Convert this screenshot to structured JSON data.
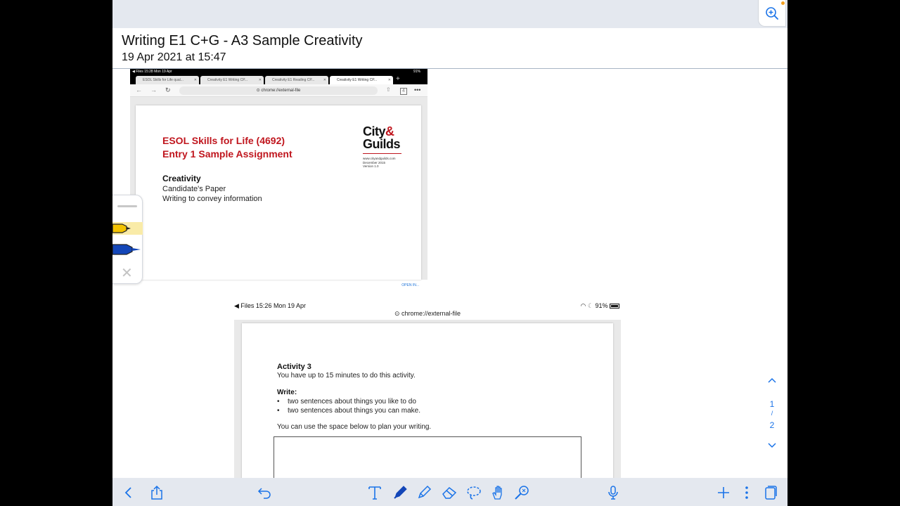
{
  "note": {
    "title": "Writing E1 C+G - A3 Sample Creativity",
    "date": "19 Apr 2021 at 15:47"
  },
  "screenshot1": {
    "status_left": "◀ Files   15:28   Mon 19 Apr",
    "status_right": "91%",
    "tabs": [
      {
        "label": "ESOL Skills for Life qual..."
      },
      {
        "label": "Creativity E1 Writing CP..."
      },
      {
        "label": "Creativity E1 Reading CP..."
      },
      {
        "label": "Creativity E1 Writing CP..."
      }
    ],
    "tab_add": "+",
    "url": "⊙ chrome://external-file",
    "doc": {
      "heading_line1": "ESOL Skills for Life (4692)",
      "heading_line2": "Entry 1 Sample Assignment",
      "logo_top": "City",
      "logo_amp": "&",
      "logo_bottom": "Guilds",
      "logo_url": "www.cityandguilds.com",
      "logo_date": "December 2015",
      "logo_version": "Version 1.0",
      "subtitle": "Creativity",
      "line1": "Candidate's Paper",
      "line2": "Writing to convey information"
    },
    "open_in": "OPEN IN..."
  },
  "screenshot2": {
    "status_left": "◀ Files   15:26   Mon 19 Apr",
    "status_right": "91%",
    "url": "⊙ chrome://external-file",
    "doc": {
      "activity_title": "Activity 3",
      "time_note": "You have up to 15 minutes to do this activity.",
      "write_label": "Write:",
      "bullets": [
        "two sentences about things you like to do",
        "two sentences about things you can make."
      ],
      "plan_note": "You can use the space below to plan your writing."
    }
  },
  "pager": {
    "current": "1",
    "separator": "/",
    "total": "2"
  },
  "colors": {
    "accent": "#1a73e8",
    "brand_red": "#c0161e",
    "highlighter": "#f2c200",
    "pen_blue": "#1346b8"
  }
}
